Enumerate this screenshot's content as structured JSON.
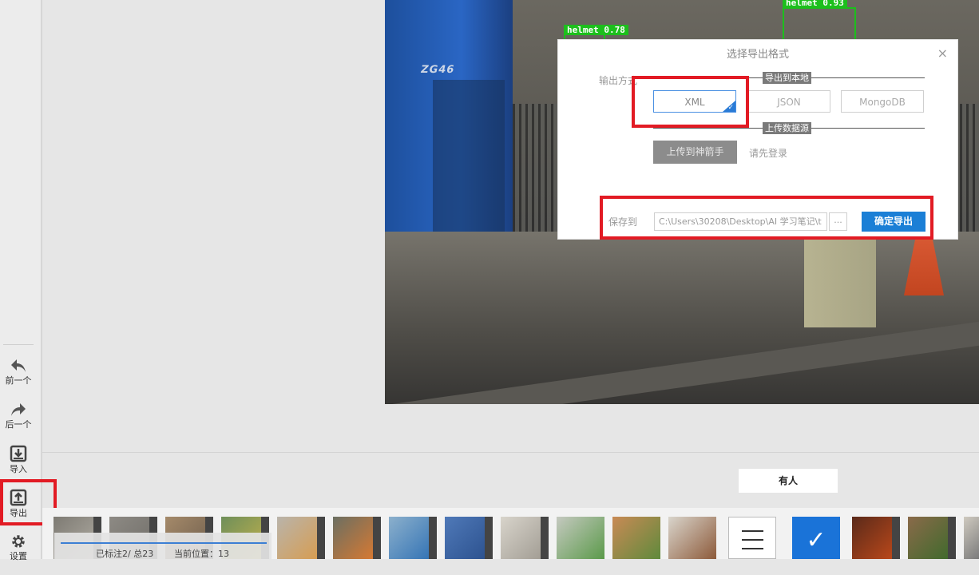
{
  "sidebar": {
    "prev_label": "前一个",
    "next_label": "后一个",
    "import_label": "导入",
    "export_label": "导出",
    "settings_label": "设置"
  },
  "image": {
    "detections": [
      {
        "label": "helmet 0.78"
      },
      {
        "label": "helmet 0.93"
      }
    ],
    "truck_text": "ZG46"
  },
  "dialog": {
    "title": "选择导出格式",
    "close": "×",
    "output_method_label": "输出方式",
    "local_section": "导出到本地",
    "formats": [
      "XML",
      "JSON",
      "MongoDB"
    ],
    "selected_format": "XML",
    "upload_section": "上传数据源",
    "upload_button": "上传到神箭手",
    "login_hint": "请先登录",
    "save_to_label": "保存到",
    "save_path": "C:\\Users\\30208\\Desktop\\AI 学习笔记\\t",
    "browse_button": "...",
    "confirm_button": "确定导出"
  },
  "tag": {
    "value": "有人"
  },
  "status": {
    "annotated": "已标注2/ 总23",
    "position": "当前位置：13"
  },
  "colors": {
    "accent": "#1b7fd6",
    "highlight": "#e21b24",
    "detection": "#1cbf1c"
  }
}
